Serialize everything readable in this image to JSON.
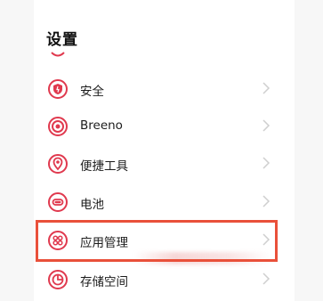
{
  "page": {
    "title": "设置"
  },
  "colors": {
    "accent": "#e0394e",
    "highlight": "#e9503a"
  },
  "items": [
    {
      "label": "安全",
      "icon": "shield-icon"
    },
    {
      "label": "Breeno",
      "icon": "breeno-icon"
    },
    {
      "label": "便捷工具",
      "icon": "location-tools-icon"
    },
    {
      "label": "电池",
      "icon": "battery-icon"
    },
    {
      "label": "应用管理",
      "icon": "app-grid-icon"
    },
    {
      "label": "存储空间",
      "icon": "storage-icon"
    }
  ]
}
